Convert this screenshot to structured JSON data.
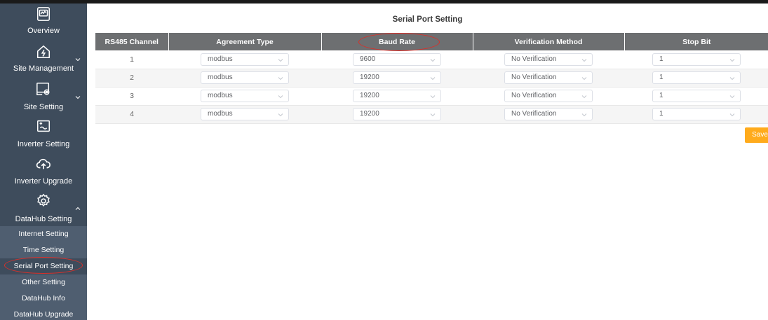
{
  "sidebar": {
    "items": [
      {
        "label": "Overview",
        "icon": "dashboard-icon"
      },
      {
        "label": "Site Management",
        "icon": "house-icon"
      },
      {
        "label": "Site Setting",
        "icon": "site-setting-icon"
      },
      {
        "label": "Inverter Setting",
        "icon": "inverter-icon"
      },
      {
        "label": "Inverter Upgrade",
        "icon": "cloud-upload-icon"
      },
      {
        "label": "DataHub Setting",
        "icon": "gear-icon"
      }
    ],
    "sub_items": [
      {
        "label": "Internet Setting"
      },
      {
        "label": "Time Setting"
      },
      {
        "label": "Serial Port Setting"
      },
      {
        "label": "Other Setting"
      },
      {
        "label": "DataHub Info"
      },
      {
        "label": "DataHub Upgrade"
      }
    ],
    "active_sub_item": "Serial Port Setting"
  },
  "main": {
    "title": "Serial Port Setting",
    "table": {
      "headers": [
        "RS485 Channel",
        "Agreement Type",
        "Baud Rate",
        "Verification Method",
        "Stop Bit"
      ],
      "rows": [
        {
          "channel": "1",
          "agreement": "modbus",
          "baud": "9600",
          "verification": "No Verification",
          "stop_bit": "1"
        },
        {
          "channel": "2",
          "agreement": "modbus",
          "baud": "19200",
          "verification": "No Verification",
          "stop_bit": "1"
        },
        {
          "channel": "3",
          "agreement": "modbus",
          "baud": "19200",
          "verification": "No Verification",
          "stop_bit": "1"
        },
        {
          "channel": "4",
          "agreement": "modbus",
          "baud": "19200",
          "verification": "No Verification",
          "stop_bit": "1"
        }
      ]
    },
    "save_label": "Save"
  },
  "colors": {
    "sidebar_bg": "#3e4c5c",
    "submenu_bg": "#4f5e70",
    "header_bg": "#6d6f71",
    "accent": "#ffab1c",
    "annotation": "#d8302a"
  }
}
